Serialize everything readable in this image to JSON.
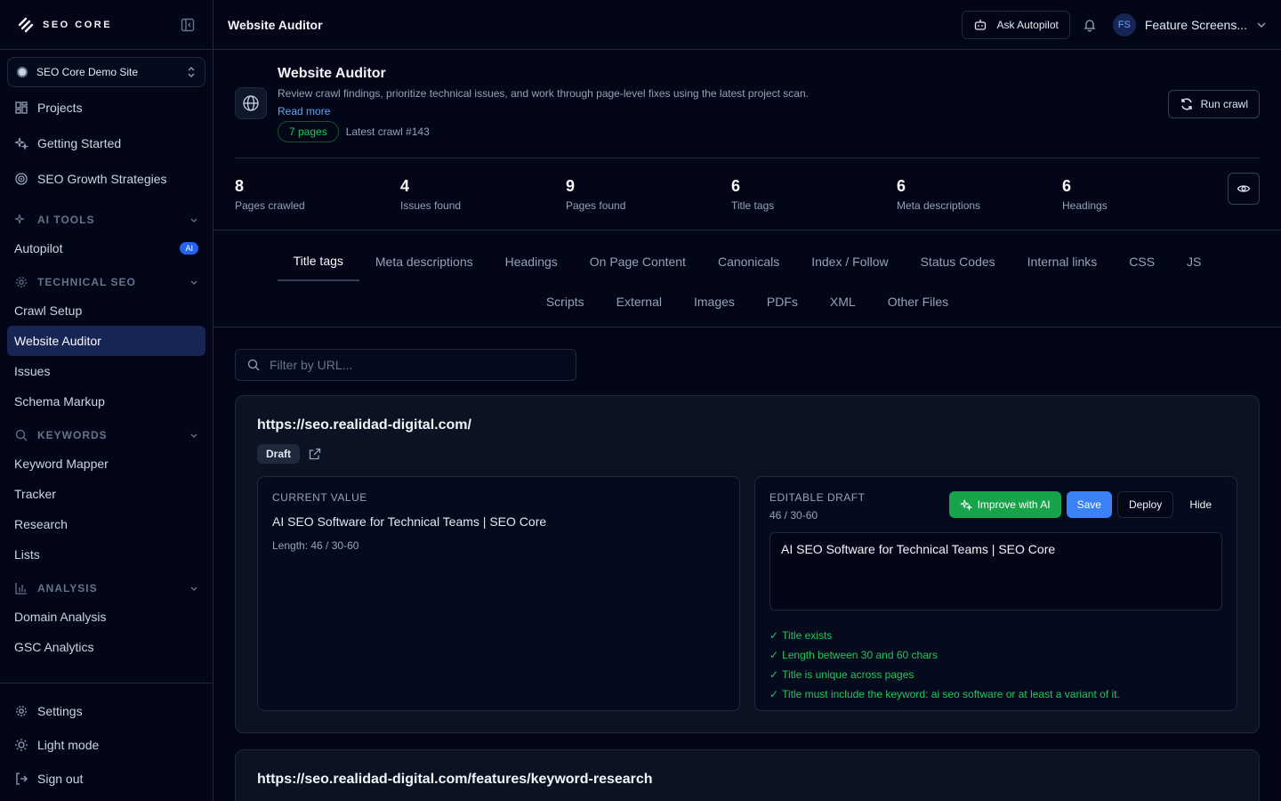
{
  "brand": {
    "name": "SEO CORE"
  },
  "sidebar": {
    "site": "SEO Core Demo Site",
    "top_items": [
      {
        "label": "Projects",
        "icon": "grid-icon"
      },
      {
        "label": "Getting Started",
        "icon": "sparkle-icon"
      },
      {
        "label": "SEO Growth Strategies",
        "icon": "target-icon"
      }
    ],
    "sections": {
      "ai_tools": {
        "label": "AI TOOLS",
        "items": [
          "Autopilot"
        ],
        "badge": "AI"
      },
      "technical": {
        "label": "TECHNICAL SEO",
        "items": [
          "Crawl Setup",
          "Website Auditor",
          "Issues",
          "Schema Markup"
        ]
      },
      "keywords": {
        "label": "KEYWORDS",
        "items": [
          "Keyword Mapper",
          "Tracker",
          "Research",
          "Lists"
        ]
      },
      "analysis": {
        "label": "ANALYSIS",
        "items": [
          "Domain Analysis",
          "GSC Analytics"
        ]
      }
    },
    "bottom": [
      "Settings",
      "Light mode",
      "Sign out"
    ]
  },
  "topbar": {
    "title": "Website Auditor",
    "ask": "Ask Autopilot",
    "avatar": "FS",
    "user": "Feature Screens..."
  },
  "header": {
    "title": "Website Auditor",
    "description": "Review crawl findings, prioritize technical issues, and work through page-level fixes using the latest project scan.",
    "read_more": "Read more",
    "pages_pill": "7 pages",
    "latest": "Latest crawl #143",
    "run_crawl": "Run crawl"
  },
  "stats": [
    {
      "num": "8",
      "label": "Pages crawled"
    },
    {
      "num": "4",
      "label": "Issues found"
    },
    {
      "num": "9",
      "label": "Pages found"
    },
    {
      "num": "6",
      "label": "Title tags"
    },
    {
      "num": "6",
      "label": "Meta descriptions"
    },
    {
      "num": "6",
      "label": "Headings"
    }
  ],
  "tabs_row1": [
    "Title tags",
    "Meta descriptions",
    "Headings",
    "On Page Content",
    "Canonicals",
    "Index / Follow",
    "Status Codes",
    "Internal links",
    "CSS",
    "JS"
  ],
  "tabs_row2": [
    "Scripts",
    "External",
    "Images",
    "PDFs",
    "XML",
    "Other Files"
  ],
  "filter": {
    "placeholder": "Filter by URL..."
  },
  "cards": [
    {
      "url": "https://seo.realidad-digital.com/",
      "badge": "Draft",
      "current_label": "CURRENT VALUE",
      "current_value": "AI SEO Software for Technical Teams | SEO Core",
      "current_length": "Length: 46 / 30-60",
      "draft_label": "EDITABLE DRAFT",
      "draft_length": "46 / 30-60",
      "draft_value": "AI SEO Software for Technical Teams | SEO Core",
      "buttons": {
        "improve": "Improve with AI",
        "save": "Save",
        "deploy": "Deploy",
        "hide": "Hide"
      },
      "checks": [
        "Title exists",
        "Length between 30 and 60 chars",
        "Title is unique across pages",
        "Title must include the keyword: ai seo software or at least a variant of it."
      ]
    },
    {
      "url": "https://seo.realidad-digital.com/features/keyword-research"
    }
  ],
  "check_mark": "✓",
  "colors": {
    "accent": "#3b82f6",
    "success": "#22c55e",
    "active_nav": "#172554"
  }
}
